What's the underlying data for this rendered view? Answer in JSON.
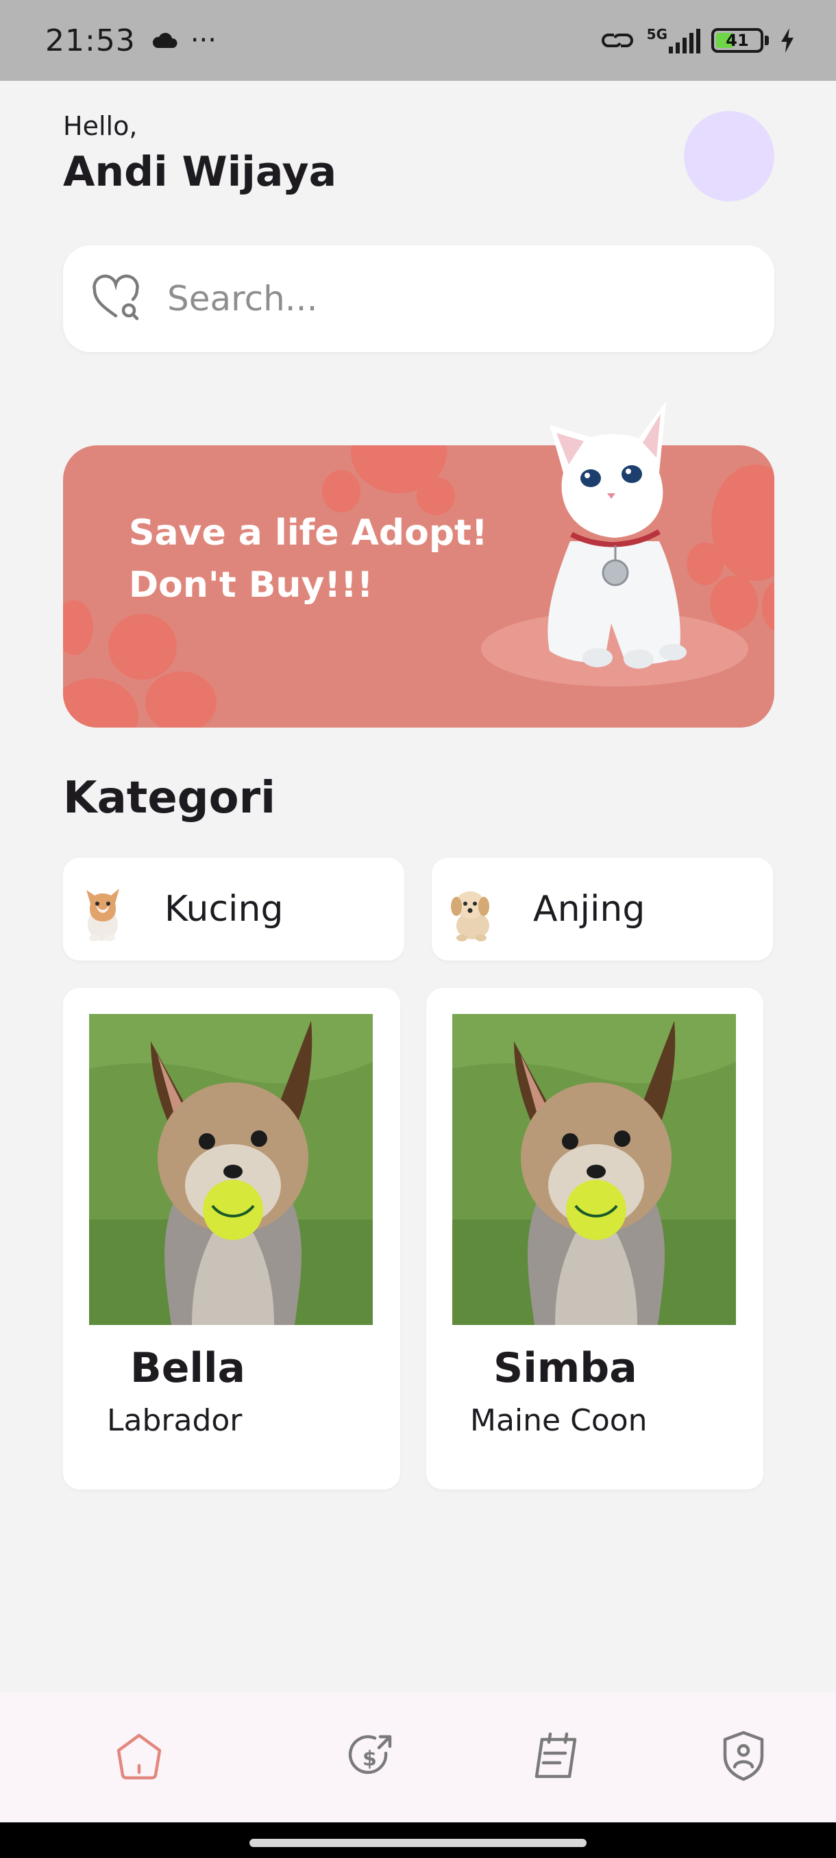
{
  "status_bar": {
    "time": "21:53",
    "dots": "···",
    "network": "5G",
    "battery": "41",
    "battery_level": 0.41
  },
  "header": {
    "greeting": "Hello,",
    "user_name": "Andi Wijaya"
  },
  "search": {
    "placeholder": "Search..."
  },
  "banner": {
    "line1": "Save a life Adopt!",
    "line2": "Don't Buy!!!"
  },
  "categories": {
    "title": "Kategori",
    "items": [
      {
        "label": "Kucing",
        "icon": "kitten-thumbnail"
      },
      {
        "label": "Anjing",
        "icon": "puppy-thumbnail"
      }
    ]
  },
  "pets": [
    {
      "name": "Bella",
      "breed": "Labrador"
    },
    {
      "name": "Simba",
      "breed": "Maine Coon"
    }
  ],
  "bottom_nav": {
    "items": [
      {
        "icon": "home-icon",
        "active": true
      },
      {
        "icon": "donation-icon",
        "active": false
      },
      {
        "icon": "schedule-icon",
        "active": false
      },
      {
        "icon": "profile-shield-icon",
        "active": false
      }
    ],
    "active_color": "#e2887e",
    "inactive_color": "#7a7a7a"
  },
  "colors": {
    "banner": "#df867c",
    "background": "#f3f3f3",
    "avatar": "#e6dcff"
  }
}
